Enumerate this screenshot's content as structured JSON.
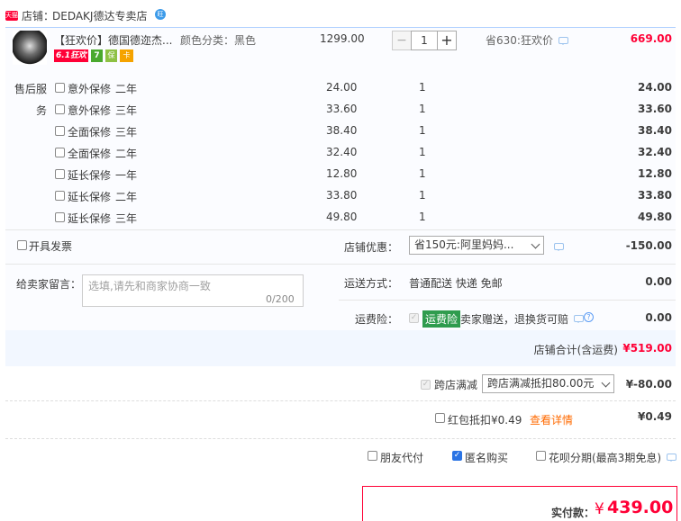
{
  "shop": {
    "badge": "天猫",
    "label": "店铺：",
    "name": "DEDAKJ德达专卖店",
    "ww": "旺"
  },
  "item": {
    "title": "【狂欢价】德国德迩杰...",
    "attr": "颜色分类：黑色",
    "price": "1299.00",
    "qty": "1",
    "qty_minus": "−",
    "qty_plus": "+",
    "promo": "省630:狂欢价",
    "subtotal": "669.00",
    "tags": [
      "6.1狂欢",
      "7",
      "保",
      "卡"
    ]
  },
  "service": {
    "label_line1": "售后服",
    "label_line2": "务",
    "options": [
      {
        "name": "意外保修",
        "period": "二年",
        "price": "24.00",
        "qty": "1",
        "total": "24.00"
      },
      {
        "name": "意外保修",
        "period": "三年",
        "price": "33.60",
        "qty": "1",
        "total": "33.60"
      },
      {
        "name": "全面保修",
        "period": "三年",
        "price": "38.40",
        "qty": "1",
        "total": "38.40"
      },
      {
        "name": "全面保修",
        "period": "二年",
        "price": "32.40",
        "qty": "1",
        "total": "32.40"
      },
      {
        "name": "延长保修",
        "period": "一年",
        "price": "12.80",
        "qty": "1",
        "total": "12.80"
      },
      {
        "name": "延长保修",
        "period": "二年",
        "price": "33.80",
        "qty": "1",
        "total": "33.80"
      },
      {
        "name": "延长保修",
        "period": "三年",
        "price": "49.80",
        "qty": "1",
        "total": "49.80"
      }
    ]
  },
  "invoice": {
    "label": "开具发票"
  },
  "shop_discount": {
    "label": "店铺优惠：",
    "selected": "省150元:阿里妈妈...",
    "amount": "-150.00"
  },
  "message": {
    "label": "给卖家留言：",
    "placeholder": "选填,请先和商家协商一致",
    "counter": "0/200"
  },
  "shipping": {
    "label": "运送方式：",
    "value": "普通配送 快递 免邮",
    "amount": "0.00"
  },
  "insurance": {
    "label": "运费险：",
    "badge": "运费险",
    "desc": "卖家赠送，退换货可赔",
    "help": "?",
    "amount": "0.00"
  },
  "shop_total": {
    "label": "店铺合计(含运费)",
    "amount": "¥519.00"
  },
  "cross_store": {
    "label": "跨店满减",
    "selected": "跨店满减抵扣80.00元",
    "amount": "¥-80.00"
  },
  "hongbao": {
    "label": "红包抵扣¥0.49",
    "link": "查看详情",
    "amount": "¥0.49"
  },
  "options": {
    "friend_pay": "朋友代付",
    "anonymous": "匿名购买",
    "huabei": "花呗分期(最高3期免息)"
  },
  "footer": {
    "label": "实付款：",
    "currency": "¥",
    "amount": "439.00"
  },
  "colors": {
    "accent": "#ff0036",
    "panel": "#fbfcff",
    "border": "#b2d1ff",
    "link": "#ff6a00"
  }
}
